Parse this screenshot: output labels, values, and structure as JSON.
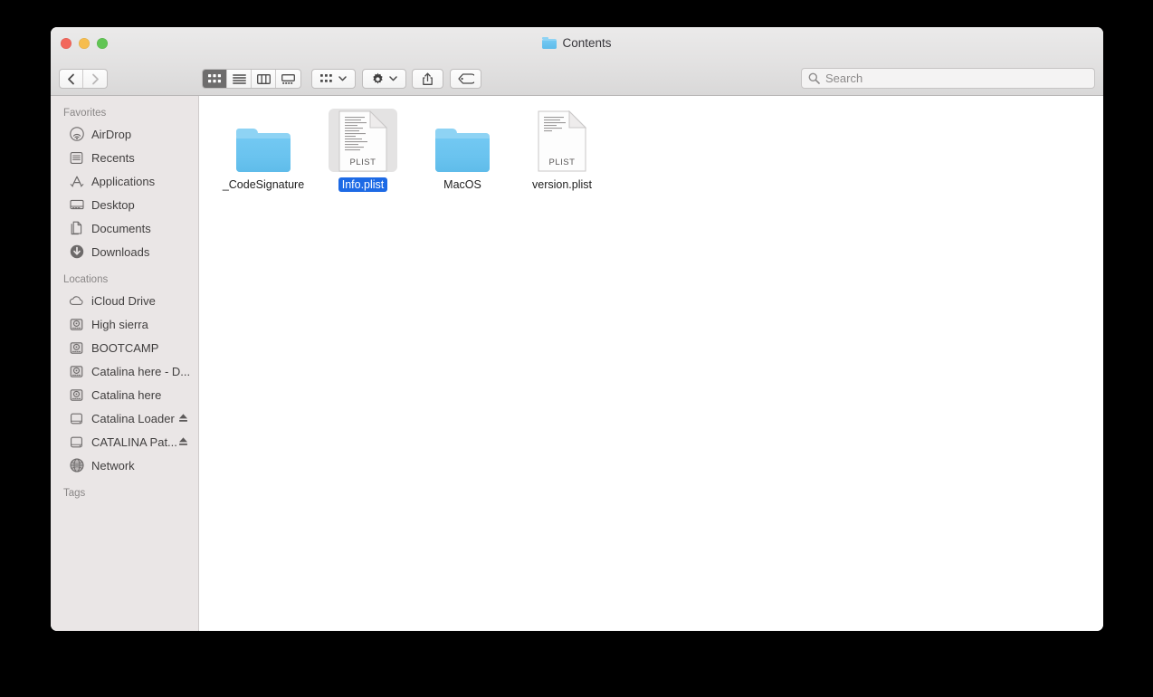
{
  "window": {
    "title": "Contents",
    "title_icon": "folder-icon",
    "traffic_lights": [
      {
        "name": "close-button",
        "color": "#f2675c"
      },
      {
        "name": "minimize-button",
        "color": "#f6bd4f"
      },
      {
        "name": "zoom-button",
        "color": "#61c554"
      }
    ]
  },
  "toolbar": {
    "nav": [
      {
        "name": "back-button",
        "icon": "chevron-left-icon",
        "enabled": true
      },
      {
        "name": "forward-button",
        "icon": "chevron-right-icon",
        "enabled": false
      }
    ],
    "view_modes": [
      {
        "name": "icon-view-button",
        "icon": "grid-icon",
        "active": true
      },
      {
        "name": "list-view-button",
        "icon": "list-icon",
        "active": false
      },
      {
        "name": "column-view-button",
        "icon": "columns-icon",
        "active": false
      },
      {
        "name": "gallery-view-button",
        "icon": "gallery-icon",
        "active": false
      }
    ],
    "group_button": {
      "name": "group-items-button",
      "icon": "grid-small-icon",
      "chevron": "chevron-down-icon"
    },
    "action_button": {
      "name": "action-menu-button",
      "icon": "gear-icon",
      "chevron": "chevron-down-icon"
    },
    "share_button": {
      "name": "share-button",
      "icon": "share-icon"
    },
    "tag_button": {
      "name": "tag-button",
      "icon": "tag-icon"
    }
  },
  "search": {
    "icon": "search-icon",
    "value": "",
    "placeholder": "Search"
  },
  "sidebar": {
    "sections": [
      {
        "header": "Favorites",
        "items": [
          {
            "label": "AirDrop",
            "icon": "airdrop-icon",
            "eject": false
          },
          {
            "label": "Recents",
            "icon": "recents-icon",
            "eject": false
          },
          {
            "label": "Applications",
            "icon": "applications-icon",
            "eject": false
          },
          {
            "label": "Desktop",
            "icon": "desktop-icon",
            "eject": false
          },
          {
            "label": "Documents",
            "icon": "documents-icon",
            "eject": false
          },
          {
            "label": "Downloads",
            "icon": "downloads-icon",
            "eject": false
          }
        ]
      },
      {
        "header": "Locations",
        "items": [
          {
            "label": "iCloud Drive",
            "icon": "icloud-icon",
            "eject": false
          },
          {
            "label": "High sierra",
            "icon": "internal-drive-icon",
            "eject": false
          },
          {
            "label": "BOOTCAMP",
            "icon": "internal-drive-icon",
            "eject": false
          },
          {
            "label": "Catalina here  - D...",
            "icon": "internal-drive-icon",
            "eject": false
          },
          {
            "label": "Catalina here",
            "icon": "internal-drive-icon",
            "eject": false
          },
          {
            "label": "Catalina Loader",
            "icon": "external-drive-icon",
            "eject": true
          },
          {
            "label": "CATALINA Pat...",
            "icon": "external-drive-icon",
            "eject": true
          },
          {
            "label": "Network",
            "icon": "network-icon",
            "eject": false
          }
        ]
      },
      {
        "header": "Tags",
        "items": []
      }
    ]
  },
  "content": {
    "items": [
      {
        "label": "_CodeSignature",
        "kind": "folder",
        "selected": false
      },
      {
        "label": "Info.plist",
        "kind": "plist",
        "selected": true,
        "badge": "PLIST"
      },
      {
        "label": "MacOS",
        "kind": "folder",
        "selected": false
      },
      {
        "label": "version.plist",
        "kind": "plist",
        "selected": false,
        "badge": "PLIST"
      }
    ]
  },
  "colors": {
    "selection_blue": "#1d6ae5",
    "folder_blue": "#6ac3ef",
    "sidebar_bg": "#eae6e6",
    "toolbar_bg": "#e0dfdf"
  }
}
